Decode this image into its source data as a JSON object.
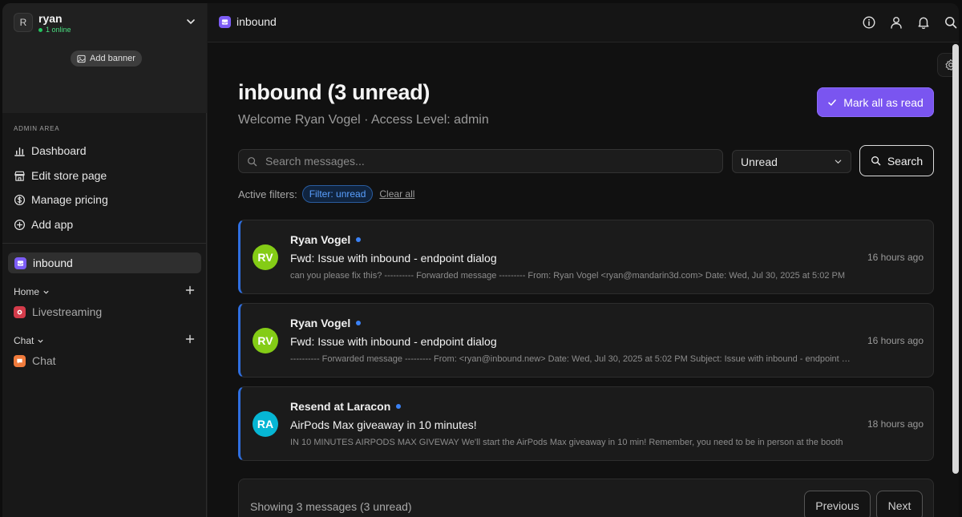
{
  "workspace": {
    "initial": "R",
    "name": "ryan",
    "status": "1 online",
    "add_banner": "Add banner"
  },
  "sidebar": {
    "section_label": "ADMIN AREA",
    "admin_items": [
      {
        "label": "Dashboard",
        "icon": "bar-chart-icon"
      },
      {
        "label": "Edit store page",
        "icon": "store-icon"
      },
      {
        "label": "Manage pricing",
        "icon": "dollar-icon"
      },
      {
        "label": "Add app",
        "icon": "plus-circle-icon"
      }
    ],
    "active_app": "inbound",
    "groups": [
      {
        "label": "Home",
        "items": [
          {
            "label": "Livestreaming"
          }
        ]
      },
      {
        "label": "Chat",
        "items": [
          {
            "label": "Chat"
          }
        ]
      }
    ]
  },
  "topbar": {
    "title": "inbound"
  },
  "page": {
    "title": "inbound (3 unread)",
    "subtitle": "Welcome Ryan Vogel · Access Level: admin",
    "mark_all_label": "Mark all as read"
  },
  "search": {
    "placeholder": "Search messages...",
    "filter_value": "Unread",
    "button_label": "Search"
  },
  "filters": {
    "label": "Active filters:",
    "chip": "Filter: unread",
    "clear_label": "Clear all"
  },
  "messages": [
    {
      "initials": "RV",
      "avatar_color": "#84cc16",
      "sender": "Ryan Vogel",
      "subject": "Fwd: Issue with inbound - endpoint dialog",
      "preview": "can you please fix this? ---------- Forwarded message --------- From: Ryan Vogel <ryan@mandarin3d.com> Date: Wed, Jul 30, 2025 at 5:02 PM",
      "time": "16 hours ago"
    },
    {
      "initials": "RV",
      "avatar_color": "#84cc16",
      "sender": "Ryan Vogel",
      "subject": "Fwd: Issue with inbound - endpoint dialog",
      "preview": "---------- Forwarded message --------- From: <ryan@inbound.new> Date: Wed, Jul 30, 2025 at 5:02 PM Subject: Issue with inbound - endpoint dialog",
      "time": "16 hours ago"
    },
    {
      "initials": "RA",
      "avatar_color": "#06b6d4",
      "sender": "Resend at Laracon",
      "subject": "AirPods Max giveaway in 10 minutes!",
      "preview": "IN 10 MINUTES AIRPODS MAX GIVEWAY We'll start the AirPods Max giveaway in 10 min! Remember, you need to be in person at the booth",
      "time": "18 hours ago"
    }
  ],
  "footer": {
    "count": "Showing 3 messages (3 unread)",
    "prev": "Previous",
    "next": "Next"
  },
  "colors": {
    "accent": "#7a55f0",
    "unread": "#3b82f6",
    "online": "#22c55e"
  }
}
